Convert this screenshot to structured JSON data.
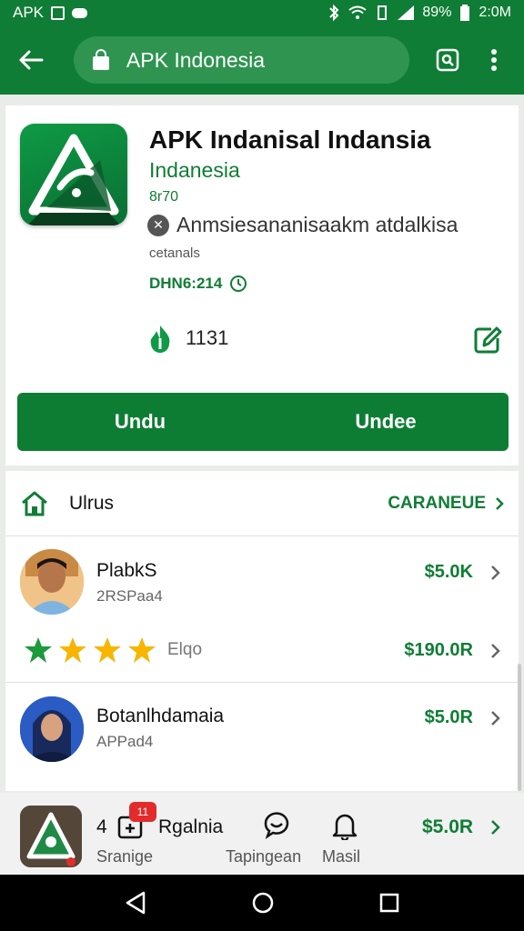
{
  "status_bar": {
    "carrier": "APK",
    "battery": "89%",
    "time": "2:0M"
  },
  "toolbar": {
    "url": "APK Indonesia"
  },
  "app": {
    "title": "APK  Indanisal Indansia",
    "developer": "Indanesia",
    "size": "8r70",
    "description": "Anmsiesananisaakm atdalkisa",
    "sub_label": "cetanals",
    "version": "DHN6:214",
    "rating_count": "1131",
    "install_left": "Undu",
    "install_right": "Undee"
  },
  "section": {
    "title": "Ulrus",
    "more": "CARANEUE"
  },
  "items": [
    {
      "name": "PlabkS",
      "sub": "2RSPaa4",
      "price": "$5.0K"
    },
    {
      "stars_label": "Elqo",
      "price": "$190.0R"
    },
    {
      "name": "Botanlhdamaia",
      "sub": "APPad4",
      "price": "$5.0R"
    }
  ],
  "bottom_strip": {
    "count": "4",
    "badge": "11",
    "name": "Rgalnia",
    "sub": "Sranige",
    "tab1": "Tapingean",
    "tab2": "Masil",
    "price": "$5.0R"
  },
  "colors": {
    "brand": "#0f7d35",
    "star": "#f7b500",
    "badge": "#e32b2b"
  }
}
